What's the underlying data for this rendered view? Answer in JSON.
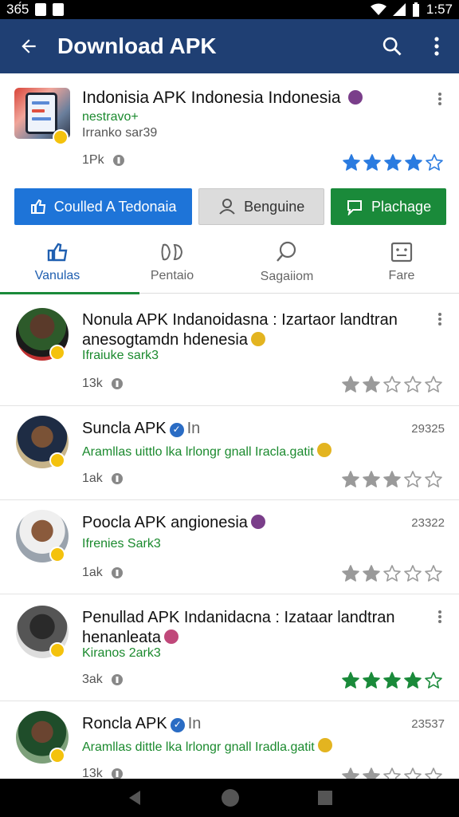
{
  "status_bar": {
    "time": "1:57",
    "left_text": "36̈́5"
  },
  "app_bar": {
    "title": "Download APK"
  },
  "hero": {
    "title": "Indonisia APK Indonesia Indonesia",
    "sub1": "nestravo+",
    "sub2": "Irranko sar39",
    "count": "1Pk",
    "rating": 4.5
  },
  "buttons": [
    {
      "label": "Coulled A Tedonaia"
    },
    {
      "label": "Benguine"
    },
    {
      "label": "Plachage"
    }
  ],
  "tabs": [
    {
      "label": "Vanulas"
    },
    {
      "label": "Pentaio"
    },
    {
      "label": "Sagaiiom"
    },
    {
      "label": "Fare"
    }
  ],
  "list": [
    {
      "title_line1": "Nonula APK Indanoidasna : Izartaor landtran",
      "title_line2": "anesogtamdn hdenesia",
      "green": "Ifraiuke sark3",
      "count": "13k",
      "number": "",
      "stars": 2
    },
    {
      "title_line1": "Suncla APK",
      "title_suffix": "In",
      "title_line2": "",
      "green": "Aramllas uittlo lka lrlongr gnall Iracla.gatit",
      "count": "1ak",
      "number": "29325",
      "stars": 3
    },
    {
      "title_line1": "Poocla APK angionesia",
      "title_line2": "",
      "green": "Ifrenies Sark3",
      "count": "1ak",
      "number": "23322",
      "stars": 2
    },
    {
      "title_line1": "Penullad APK Indanidacna : Izataar landtran",
      "title_line2": "henanleata",
      "green": "Kiranos 2ark3",
      "count": "3ak",
      "number": "",
      "stars": 4.5
    },
    {
      "title_line1": "Roncla APK",
      "title_suffix": "In",
      "title_line2": "",
      "green": "Aramllas dittle lka lrlongr gnall Iradla.gatit",
      "count": "13k",
      "number": "23537",
      "stars": 2
    }
  ],
  "colors": {
    "appbar": "#1f3f73",
    "accent_blue": "#1e74d8",
    "accent_green": "#1a8a3a",
    "star_blue": "#2a7be0",
    "star_green": "#1a8a3a",
    "star_grey": "#9a9a9a"
  }
}
